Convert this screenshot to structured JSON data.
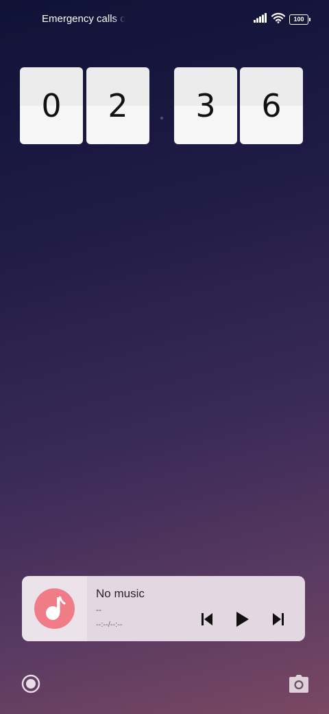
{
  "status_bar": {
    "carrier_text": "Emergency calls only",
    "battery_level": "100",
    "icons": [
      "signal-icon",
      "wifi-icon",
      "battery-icon"
    ]
  },
  "clock": {
    "hour_tens": "0",
    "hour_ones": "2",
    "minute_tens": "3",
    "minute_ones": "6"
  },
  "music": {
    "title": "No music",
    "artist": "--",
    "time": "--:--/--:--",
    "accent_color": "#ef7c86",
    "controls": [
      "previous-icon",
      "play-icon",
      "next-icon"
    ]
  },
  "shortcuts": {
    "left": "record-icon",
    "right": "camera-icon"
  }
}
